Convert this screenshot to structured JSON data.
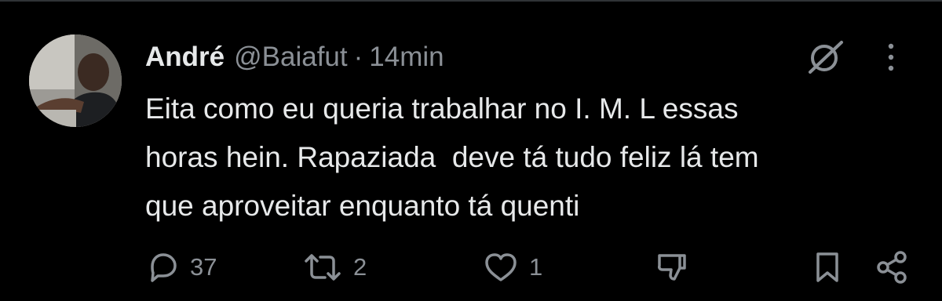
{
  "tweet": {
    "author_name": "André",
    "handle": "@Baiafut",
    "separator": "·",
    "time": "14min",
    "text_lines": [
      "Eita como eu queria trabalhar no I. M. L essas",
      "horas hein. Rapaziada  deve tá tudo feliz lá tem",
      "que aproveitar enquanto tá quenti"
    ]
  },
  "actions": {
    "reply_count": "37",
    "retweet_count": "2",
    "like_count": "1"
  },
  "icons": {
    "grok": "grok-icon",
    "more": "more-icon",
    "reply": "reply-icon",
    "retweet": "retweet-icon",
    "like": "like-icon",
    "dislike": "dislike-icon",
    "bookmark": "bookmark-icon",
    "share": "share-icon"
  },
  "colors": {
    "background": "#000000",
    "text": "#e7e9ea",
    "secondary": "#8b9096",
    "border": "#2f3336"
  }
}
